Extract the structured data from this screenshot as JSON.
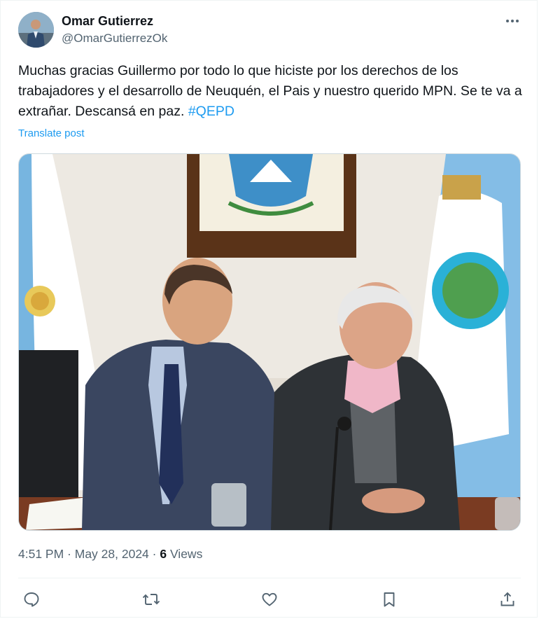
{
  "author": {
    "name": "Omar Gutierrez",
    "handle": "@OmarGutierrezOk",
    "avatar_icon": "profile-photo"
  },
  "post": {
    "text": "Muchas gracias Guillermo por todo lo que hiciste por los derechos de los trabajadores y el desarrollo de Neuquén, el Pais y nuestro querido MPN. Se te va a extrañar. Descansá en paz. ",
    "hashtag": "#QEPD",
    "translate_label": "Translate post",
    "media_icon": "photo-two-men-at-table"
  },
  "meta": {
    "time": "4:51 PM",
    "separator1": " · ",
    "date": "May 28, 2024",
    "separator2": " · ",
    "views_count": "6",
    "views_label": " Views"
  },
  "actions": [
    {
      "icon": "reply-icon"
    },
    {
      "icon": "retweet-icon"
    },
    {
      "icon": "like-icon"
    },
    {
      "icon": "bookmark-icon"
    },
    {
      "icon": "share-icon"
    }
  ],
  "colors": {
    "text_primary": "#0f1419",
    "text_secondary": "#536471",
    "link": "#1d9bf0",
    "border": "#cfd9de"
  }
}
